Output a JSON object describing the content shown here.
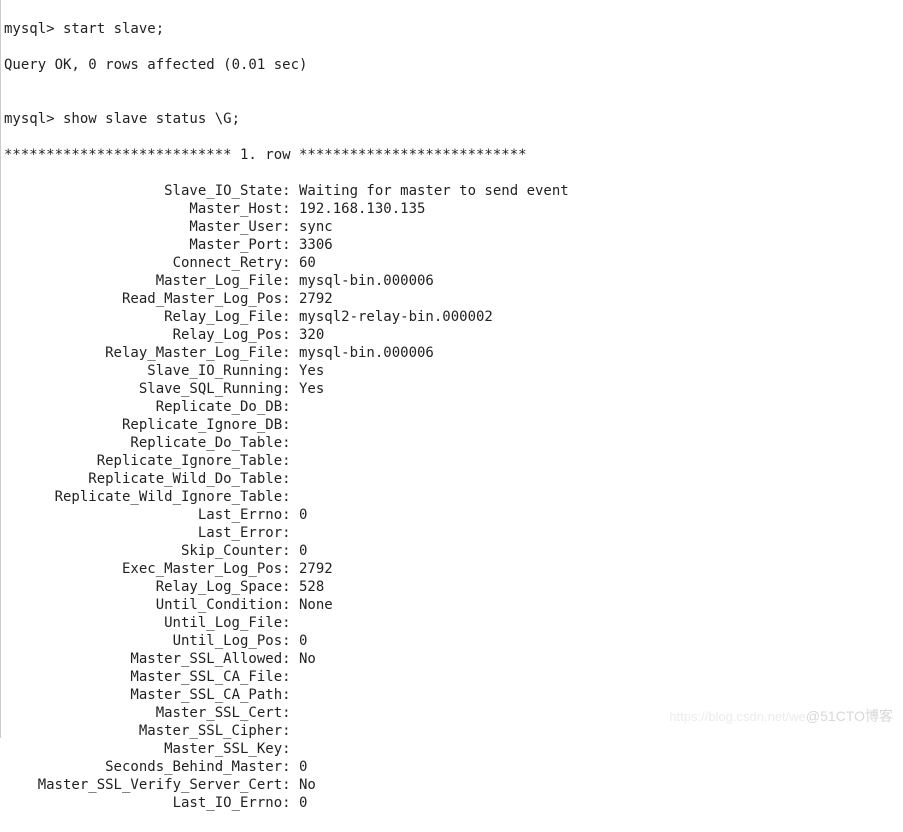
{
  "prompt1": "mysql> start slave;",
  "response1": "Query OK, 0 rows affected (0.01 sec)",
  "blank": "",
  "prompt2": "mysql> show slave status \\G;",
  "rowheader": "*************************** 1. row ***************************",
  "status": [
    {
      "key": "Slave_IO_State",
      "value": "Waiting for master to send event"
    },
    {
      "key": "Master_Host",
      "value": "192.168.130.135"
    },
    {
      "key": "Master_User",
      "value": "sync"
    },
    {
      "key": "Master_Port",
      "value": "3306"
    },
    {
      "key": "Connect_Retry",
      "value": "60"
    },
    {
      "key": "Master_Log_File",
      "value": "mysql-bin.000006"
    },
    {
      "key": "Read_Master_Log_Pos",
      "value": "2792"
    },
    {
      "key": "Relay_Log_File",
      "value": "mysql2-relay-bin.000002"
    },
    {
      "key": "Relay_Log_Pos",
      "value": "320"
    },
    {
      "key": "Relay_Master_Log_File",
      "value": "mysql-bin.000006"
    },
    {
      "key": "Slave_IO_Running",
      "value": "Yes"
    },
    {
      "key": "Slave_SQL_Running",
      "value": "Yes"
    },
    {
      "key": "Replicate_Do_DB",
      "value": ""
    },
    {
      "key": "Replicate_Ignore_DB",
      "value": ""
    },
    {
      "key": "Replicate_Do_Table",
      "value": ""
    },
    {
      "key": "Replicate_Ignore_Table",
      "value": ""
    },
    {
      "key": "Replicate_Wild_Do_Table",
      "value": ""
    },
    {
      "key": "Replicate_Wild_Ignore_Table",
      "value": ""
    },
    {
      "key": "Last_Errno",
      "value": "0"
    },
    {
      "key": "Last_Error",
      "value": ""
    },
    {
      "key": "Skip_Counter",
      "value": "0"
    },
    {
      "key": "Exec_Master_Log_Pos",
      "value": "2792"
    },
    {
      "key": "Relay_Log_Space",
      "value": "528"
    },
    {
      "key": "Until_Condition",
      "value": "None"
    },
    {
      "key": "Until_Log_File",
      "value": ""
    },
    {
      "key": "Until_Log_Pos",
      "value": "0"
    },
    {
      "key": "Master_SSL_Allowed",
      "value": "No"
    },
    {
      "key": "Master_SSL_CA_File",
      "value": ""
    },
    {
      "key": "Master_SSL_CA_Path",
      "value": ""
    },
    {
      "key": "Master_SSL_Cert",
      "value": ""
    },
    {
      "key": "Master_SSL_Cipher",
      "value": ""
    },
    {
      "key": "Master_SSL_Key",
      "value": ""
    },
    {
      "key": "Seconds_Behind_Master",
      "value": "0"
    },
    {
      "key": "Master_SSL_Verify_Server_Cert",
      "value": "No"
    },
    {
      "key": "Last_IO_Errno",
      "value": "0"
    }
  ],
  "watermark": {
    "url": "https://blog.csdn.net/we",
    "text": "@51CTO博客"
  }
}
